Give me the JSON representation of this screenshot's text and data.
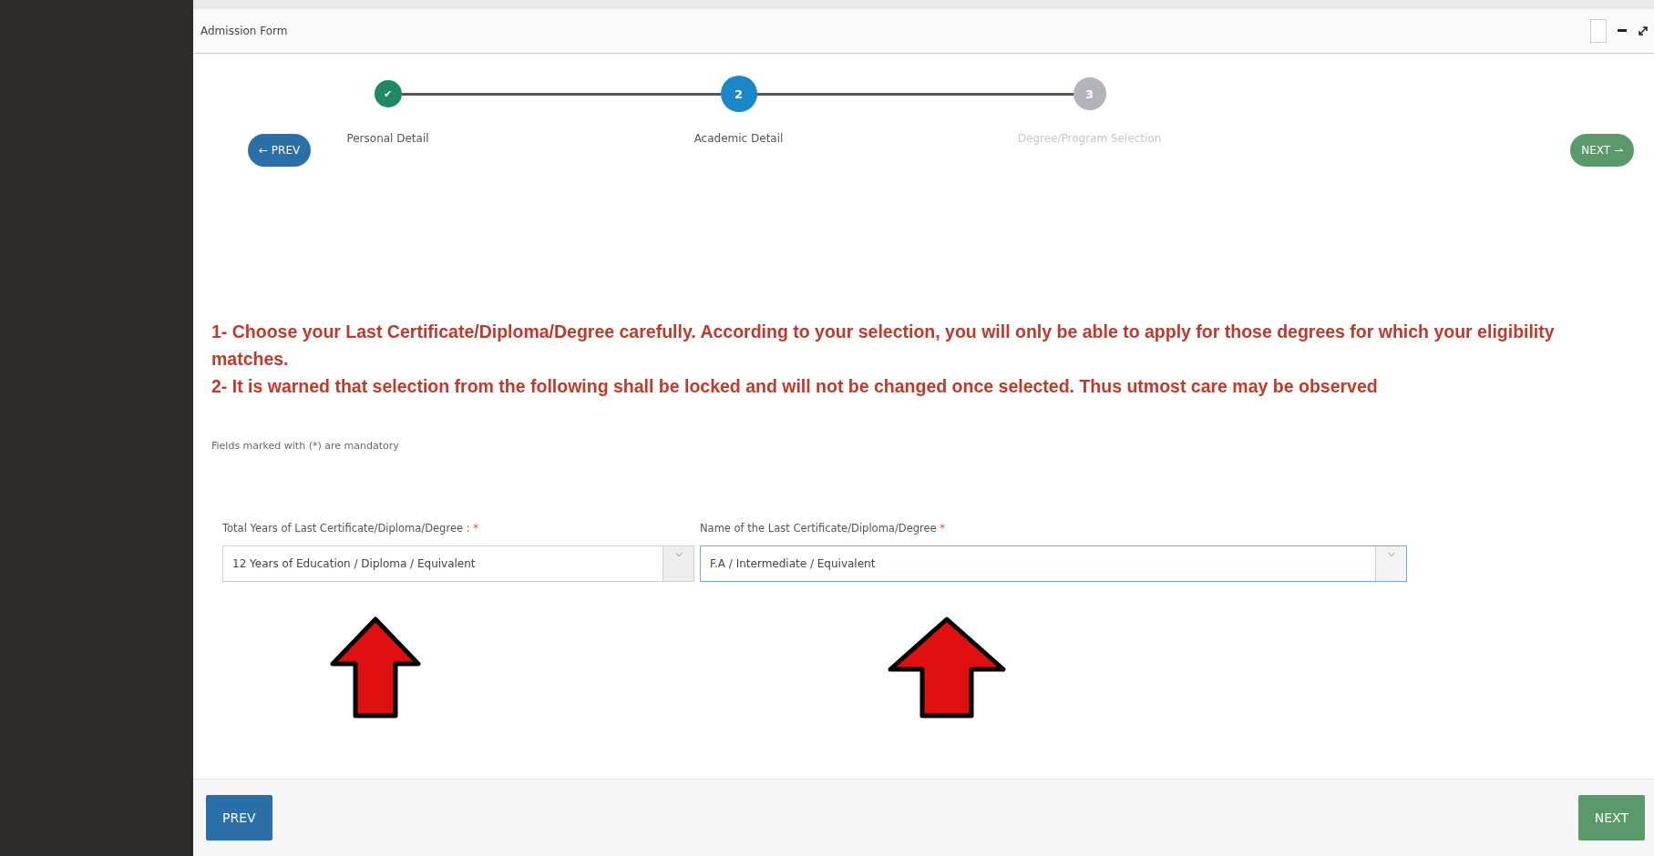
{
  "window": {
    "title": "Admission Form"
  },
  "steps": [
    {
      "number": "✔",
      "label": "Personal Detail",
      "kind": "done"
    },
    {
      "number": "2",
      "label": "Academic Detail",
      "kind": "active"
    },
    {
      "number": "3",
      "label": "Degree/Program Selection",
      "kind": "pending"
    }
  ],
  "top_nav": {
    "prev": "← PREV",
    "next": "NEXT ⇀"
  },
  "warnings": [
    "1- Choose your Last Certificate/Diploma/Degree carefully. According to your selection, you will only be able to apply for those degrees for which your eligibility matches.",
    "2- It is warned that selection from the following shall be locked and will not be changed once selected. Thus utmost care may be observed"
  ],
  "mandatory_note": "Fields marked with (*) are mandatory",
  "fields": [
    {
      "label": "Total Years of Last Certificate/Diploma/Degree :",
      "required": "*",
      "value": "12 Years of Education / Diploma / Equivalent",
      "focused": false
    },
    {
      "label": "Name of the Last Certificate/Diploma/Degree",
      "required": "*",
      "value": "F.A / Intermediate / Equivalent",
      "focused": true
    }
  ],
  "footer": {
    "prev": "PREV",
    "next": "NEXT"
  }
}
